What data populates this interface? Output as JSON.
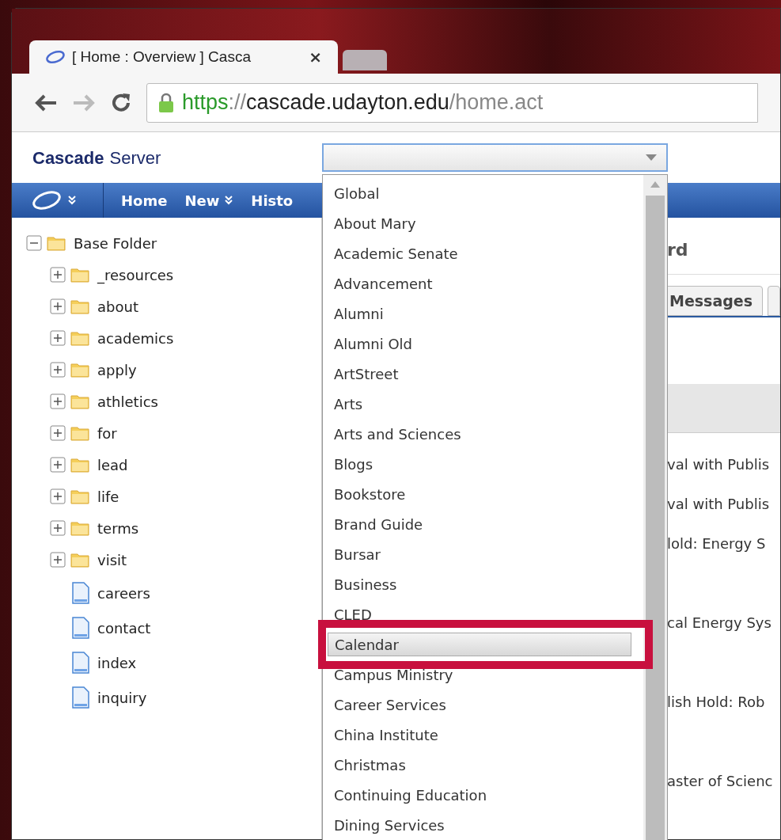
{
  "browser": {
    "tab_title": "[ Home : Overview ] Casca",
    "tab_close": "×",
    "url": {
      "scheme": "https",
      "separator": "://",
      "host": "cascade.udayton.edu",
      "path": "/home.act"
    }
  },
  "app": {
    "logo_bold": "Cascade",
    "logo_light": "Server"
  },
  "nav": [
    {
      "label": "Home",
      "caret": false
    },
    {
      "label": "New",
      "caret": true
    },
    {
      "label": "Histo",
      "caret": false
    }
  ],
  "tree": {
    "label": "Base Folder",
    "kind": "folder",
    "expanded": true,
    "children": [
      {
        "label": "_resources",
        "kind": "folder",
        "expanded": false
      },
      {
        "label": "about",
        "kind": "folder",
        "expanded": false
      },
      {
        "label": "academics",
        "kind": "folder",
        "expanded": false
      },
      {
        "label": "apply",
        "kind": "folder",
        "expanded": false
      },
      {
        "label": "athletics",
        "kind": "folder",
        "expanded": false
      },
      {
        "label": "for",
        "kind": "folder",
        "expanded": false
      },
      {
        "label": "lead",
        "kind": "folder",
        "expanded": false
      },
      {
        "label": "life",
        "kind": "folder",
        "expanded": false
      },
      {
        "label": "terms",
        "kind": "folder",
        "expanded": false
      },
      {
        "label": "visit",
        "kind": "folder",
        "expanded": false
      },
      {
        "label": "careers",
        "kind": "page"
      },
      {
        "label": "contact",
        "kind": "page"
      },
      {
        "label": "index",
        "kind": "page"
      },
      {
        "label": "inquiry",
        "kind": "page"
      }
    ]
  },
  "site_dropdown": {
    "options": [
      {
        "label": "Global",
        "selected": false,
        "highlighted": false
      },
      {
        "label": "About Mary",
        "selected": false,
        "highlighted": false
      },
      {
        "label": "Academic Senate",
        "selected": false,
        "highlighted": false
      },
      {
        "label": "Advancement",
        "selected": false,
        "highlighted": false
      },
      {
        "label": "Alumni",
        "selected": false,
        "highlighted": false
      },
      {
        "label": "Alumni Old",
        "selected": false,
        "highlighted": false
      },
      {
        "label": "ArtStreet",
        "selected": false,
        "highlighted": false
      },
      {
        "label": "Arts",
        "selected": false,
        "highlighted": false
      },
      {
        "label": "Arts and Sciences",
        "selected": false,
        "highlighted": false
      },
      {
        "label": "Blogs",
        "selected": false,
        "highlighted": false
      },
      {
        "label": "Bookstore",
        "selected": false,
        "highlighted": false
      },
      {
        "label": "Brand Guide",
        "selected": false,
        "highlighted": false
      },
      {
        "label": "Bursar",
        "selected": false,
        "highlighted": false
      },
      {
        "label": "Business",
        "selected": false,
        "highlighted": false
      },
      {
        "label": "CLED",
        "selected": false,
        "highlighted": false
      },
      {
        "label": "Calendar",
        "selected": true,
        "highlighted": true
      },
      {
        "label": "Campus Ministry",
        "selected": false,
        "highlighted": false
      },
      {
        "label": "Career Services",
        "selected": false,
        "highlighted": false
      },
      {
        "label": "China Institute",
        "selected": false,
        "highlighted": false
      },
      {
        "label": "Christmas",
        "selected": false,
        "highlighted": false
      },
      {
        "label": "Continuing Education",
        "selected": false,
        "highlighted": false
      },
      {
        "label": "Dining Services",
        "selected": false,
        "highlighted": false
      }
    ]
  },
  "dashboard": {
    "heading": "rd",
    "tabs": [
      {
        "label": "Messages",
        "selected": true
      }
    ],
    "messages": [
      "val with Publis",
      "val with Publis",
      "lold: Energy S",
      "cal Energy Sys",
      "lish Hold: Rob",
      "aster of Scienc"
    ]
  }
}
